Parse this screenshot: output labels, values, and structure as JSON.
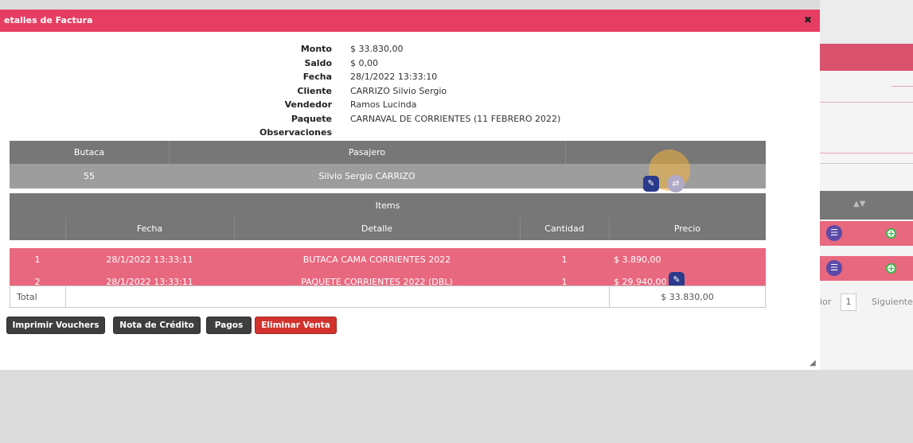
{
  "modal": {
    "title": "etalles de Factura",
    "close_glyph": "✖"
  },
  "info": [
    {
      "label": "Monto",
      "value": "$ 33.830,00"
    },
    {
      "label": "Saldo",
      "value": "$ 0,00"
    },
    {
      "label": "Fecha",
      "value": "28/1/2022 13:33:10"
    },
    {
      "label": "Cliente",
      "value": "CARRIZO Silvio Sergio"
    },
    {
      "label": "Vendedor",
      "value": "Ramos Lucinda"
    },
    {
      "label": "Paquete",
      "value": "CARNAVAL DE CORRIENTES (11 FEBRERO 2022)"
    },
    {
      "label": "Observaciones",
      "value": ""
    }
  ],
  "passengers": {
    "headers": [
      "Butaca",
      "Pasajero",
      ""
    ],
    "rows": [
      {
        "butaca": "55",
        "pasajero": "Silvio Sergio CARRIZO"
      }
    ]
  },
  "items": {
    "title": "Items",
    "headers": [
      "",
      "Fecha",
      "Detalle",
      "Cantidad",
      "Precio"
    ],
    "rows": [
      {
        "n": "1",
        "fecha": "28/1/2022 13:33:11",
        "detalle": "BUTACA CAMA CORRIENTES 2022",
        "cantidad": "1",
        "precio": "$ 3.890,00"
      },
      {
        "n": "2",
        "fecha": "28/1/2022 13:33:11",
        "detalle": "PAQUETE CORRIENTES 2022 (DBL)",
        "cantidad": "1",
        "precio": "$ 29.940,00"
      }
    ],
    "total_label": "Total",
    "total_value": "$ 33.830,00"
  },
  "actions": {
    "vouchers": "Imprimir Vouchers",
    "credit_note": "Nota de Crédito",
    "payments": "Pagos",
    "delete_sale": "Eliminar Venta"
  },
  "background": {
    "pager_prev": "ior",
    "pager_page": "1",
    "pager_next": "Siguiente"
  },
  "colors": {
    "accent": "#e63e63",
    "row_pink": "#e8687f",
    "header_gray": "#777777",
    "danger": "#d2322d"
  }
}
